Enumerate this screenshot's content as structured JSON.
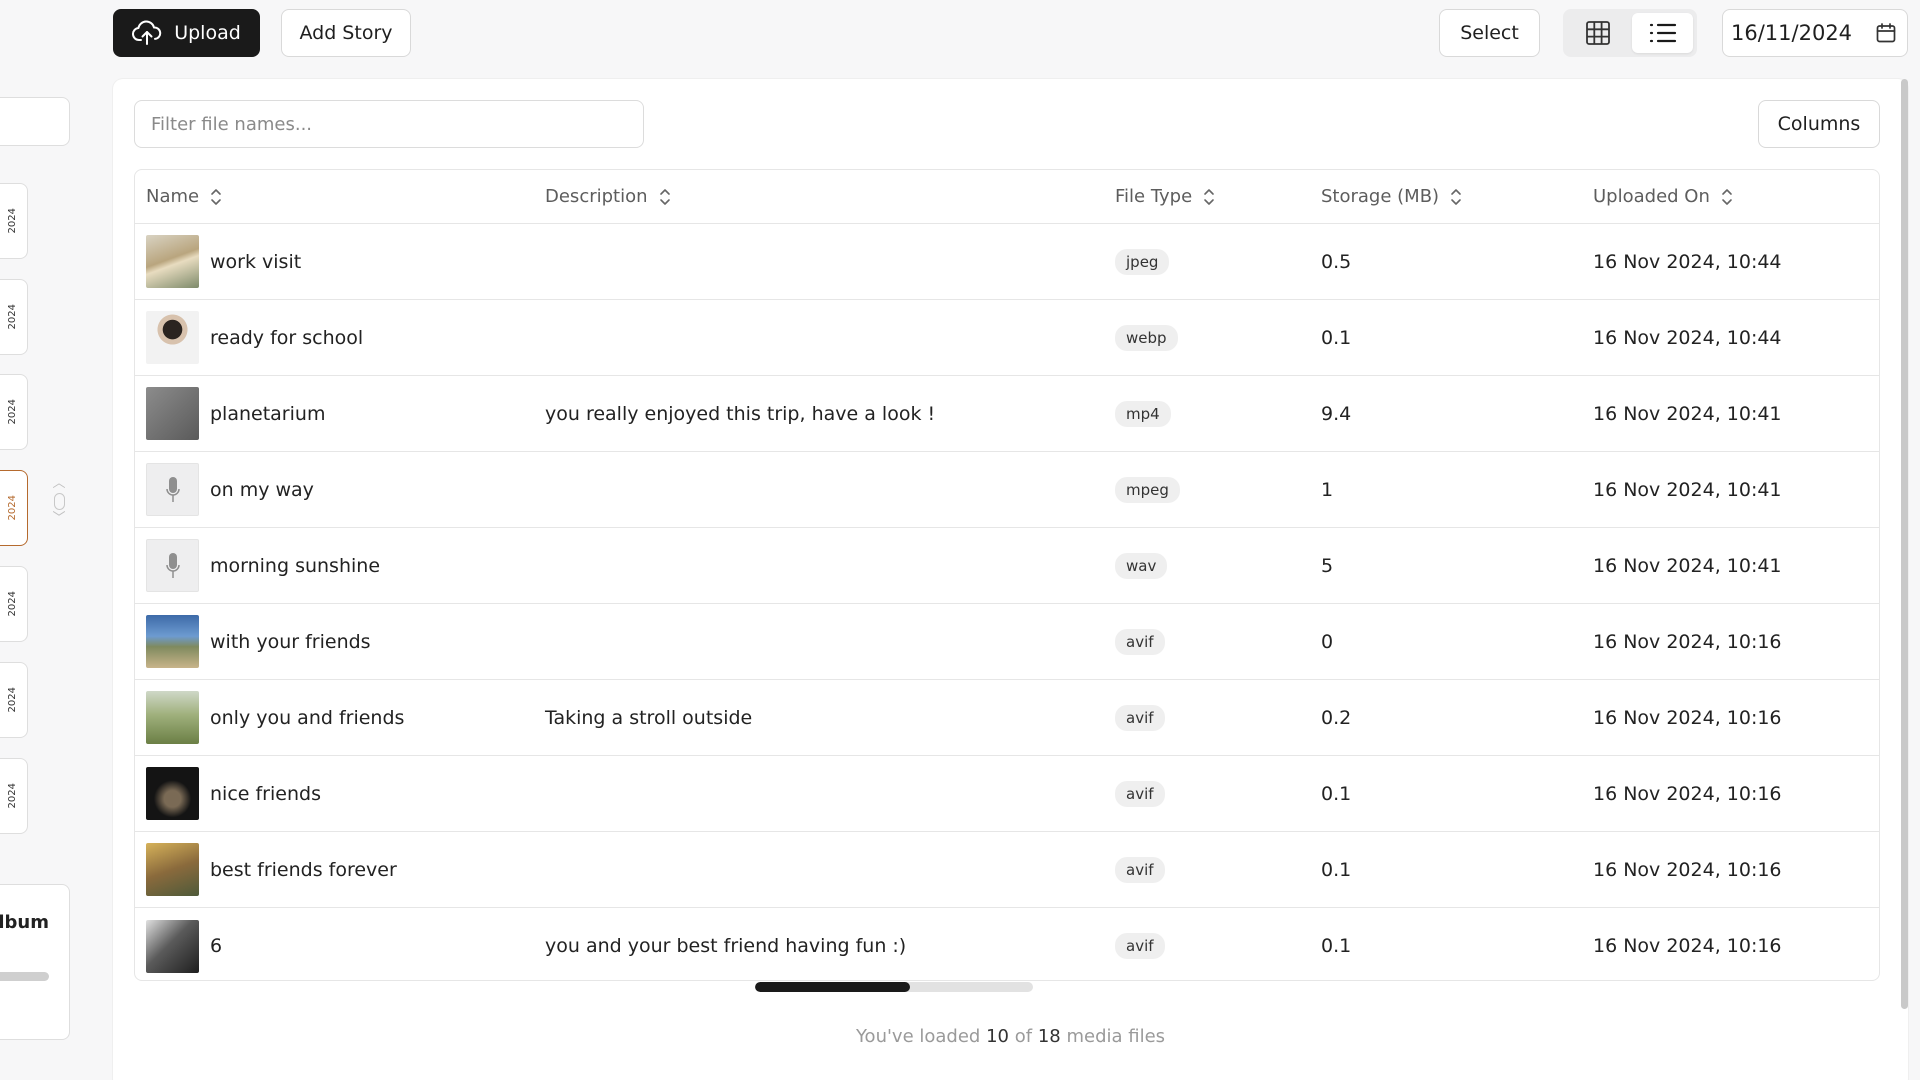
{
  "toolbar": {
    "upload_label": "Upload",
    "add_story_label": "Add Story",
    "select_label": "Select",
    "date_value": "16/11/2024"
  },
  "sidebar": {
    "date_tabs": [
      "2024",
      "2024",
      "2024",
      "2024",
      "2024",
      "2024",
      "2024"
    ],
    "active_tab_index": 3,
    "album_label": "Album"
  },
  "filter": {
    "placeholder": "Filter file names..."
  },
  "columns_label": "Columns",
  "table": {
    "headers": {
      "name": "Name",
      "description": "Description",
      "file_type": "File Type",
      "storage": "Storage (MB)",
      "uploaded_on": "Uploaded On"
    },
    "rows": [
      {
        "name": "work visit",
        "description": "",
        "type": "jpeg",
        "storage": "0.5",
        "uploaded": "16 Nov 2024, 10:44",
        "thumb": "image"
      },
      {
        "name": "ready for school",
        "description": "",
        "type": "webp",
        "storage": "0.1",
        "uploaded": "16 Nov 2024, 10:44",
        "thumb": "image"
      },
      {
        "name": "planetarium",
        "description": "you really enjoyed this trip, have a look !",
        "type": "mp4",
        "storage": "9.4",
        "uploaded": "16 Nov 2024, 10:41",
        "thumb": "video"
      },
      {
        "name": "on my way",
        "description": "",
        "type": "mpeg",
        "storage": "1",
        "uploaded": "16 Nov 2024, 10:41",
        "thumb": "audio"
      },
      {
        "name": "morning sunshine",
        "description": "",
        "type": "wav",
        "storage": "5",
        "uploaded": "16 Nov 2024, 10:41",
        "thumb": "audio"
      },
      {
        "name": "with your friends",
        "description": "",
        "type": "avif",
        "storage": "0",
        "uploaded": "16 Nov 2024, 10:16",
        "thumb": "image"
      },
      {
        "name": "only you and friends",
        "description": "Taking a stroll outside",
        "type": "avif",
        "storage": "0.2",
        "uploaded": "16 Nov 2024, 10:16",
        "thumb": "image"
      },
      {
        "name": "nice friends",
        "description": "",
        "type": "avif",
        "storage": "0.1",
        "uploaded": "16 Nov 2024, 10:16",
        "thumb": "image"
      },
      {
        "name": "best friends forever",
        "description": "",
        "type": "avif",
        "storage": "0.1",
        "uploaded": "16 Nov 2024, 10:16",
        "thumb": "image"
      },
      {
        "name": "6",
        "description": "you and your best friend having fun :)",
        "type": "avif",
        "storage": "0.1",
        "uploaded": "16 Nov 2024, 10:16",
        "thumb": "image"
      }
    ]
  },
  "footer": {
    "prefix": "You've loaded",
    "loaded": "10",
    "of_text": "of",
    "total": "18",
    "suffix": "media files",
    "progress_fraction": 0.556
  },
  "icons": {
    "upload": "cloud-upload-icon",
    "grid": "grid-icon",
    "list": "list-icon",
    "calendar": "calendar-icon",
    "sort": "sort-icon",
    "audio": "microphone-icon"
  }
}
